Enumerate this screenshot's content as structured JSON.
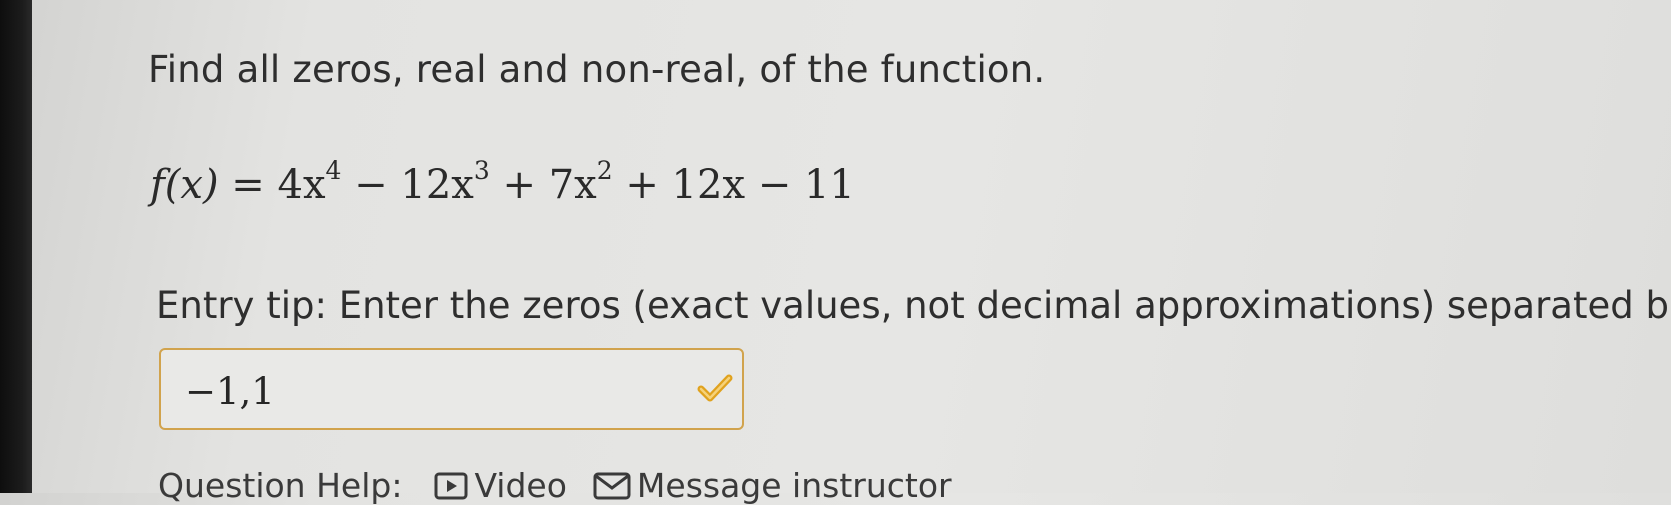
{
  "question": {
    "prompt": "Find all zeros, real and non-real, of the function."
  },
  "formula": {
    "lhs": "f(x)",
    "eq": " = 4x",
    "e4": "4",
    "t2": " − 12x",
    "e3": "3",
    "t3": " + 7x",
    "e2": "2",
    "t4": " + 12x − 11"
  },
  "entry_tip": "Entry tip: Enter the zeros (exact values, not decimal approximations) separated b",
  "answer": {
    "value": "−1,1",
    "status_icon": "check-icon",
    "border_color": "#d1a34d"
  },
  "help": {
    "label": "Question Help:",
    "video_label": "Video",
    "message_label": "Message instructor"
  },
  "colors": {
    "accent": "#e0a21e",
    "text": "#2e2e2e"
  }
}
